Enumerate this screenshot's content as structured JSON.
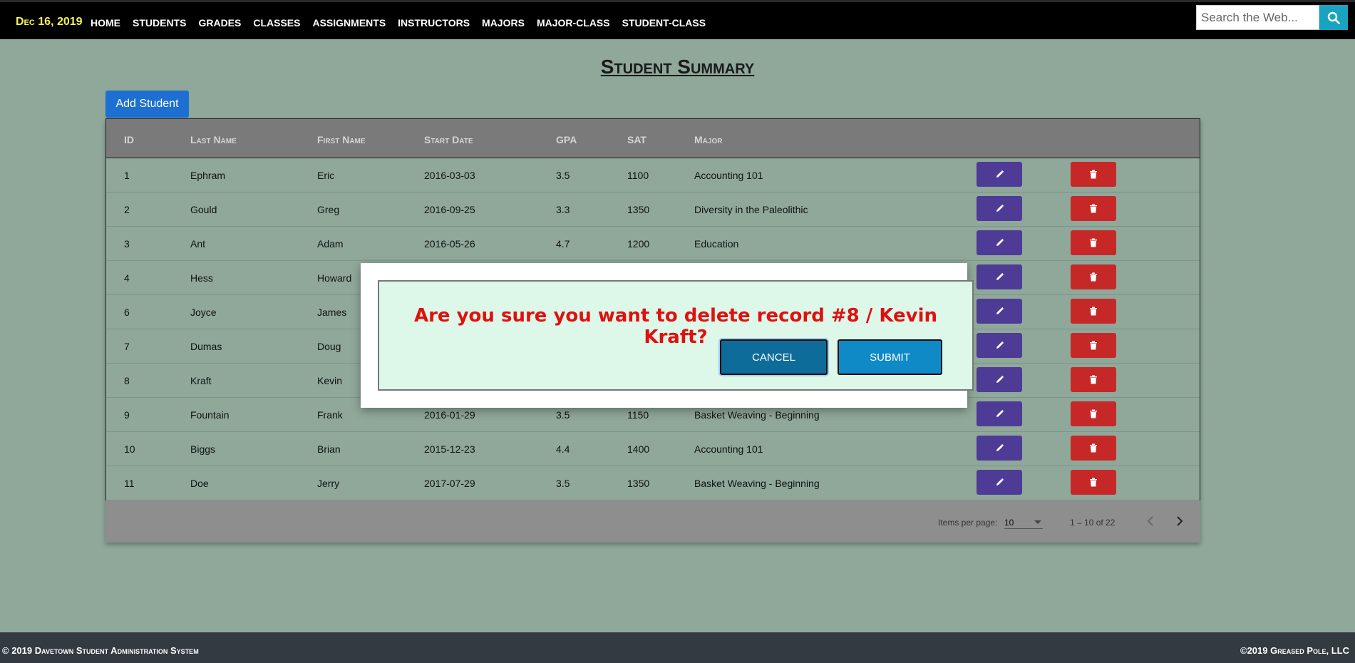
{
  "nav": {
    "date": "Dec 16, 2019",
    "links": [
      "HOME",
      "STUDENTS",
      "GRADES",
      "CLASSES",
      "ASSIGNMENTS",
      "INSTRUCTORS",
      "MAJORS",
      "MAJOR-CLASS",
      "STUDENT-CLASS"
    ],
    "search_placeholder": "Search the Web...",
    "search_icon": "search-icon"
  },
  "main": {
    "title": "Student Summary",
    "add_button": "Add Student",
    "columns": [
      "ID",
      "Last Name",
      "First Name",
      "Start Date",
      "GPA",
      "SAT",
      "Major"
    ],
    "rows": [
      {
        "id": "1",
        "last": "Ephram",
        "first": "Eric",
        "start": "2016-03-03",
        "gpa": "3.5",
        "sat": "1100",
        "major": "Accounting 101"
      },
      {
        "id": "2",
        "last": "Gould",
        "first": "Greg",
        "start": "2016-09-25",
        "gpa": "3.3",
        "sat": "1350",
        "major": "Diversity in the Paleolithic"
      },
      {
        "id": "3",
        "last": "Ant",
        "first": "Adam",
        "start": "2016-05-26",
        "gpa": "4.7",
        "sat": "1200",
        "major": "Education"
      },
      {
        "id": "4",
        "last": "Hess",
        "first": "Howard",
        "start": "",
        "gpa": "",
        "sat": "",
        "major": ""
      },
      {
        "id": "6",
        "last": "Joyce",
        "first": "James",
        "start": "",
        "gpa": "",
        "sat": "",
        "major": ""
      },
      {
        "id": "7",
        "last": "Dumas",
        "first": "Doug",
        "start": "",
        "gpa": "",
        "sat": "",
        "major": ""
      },
      {
        "id": "8",
        "last": "Kraft",
        "first": "Kevin",
        "start": "",
        "gpa": "",
        "sat": "",
        "major": ""
      },
      {
        "id": "9",
        "last": "Fountain",
        "first": "Frank",
        "start": "2016-01-29",
        "gpa": "3.5",
        "sat": "1150",
        "major": "Basket Weaving - Beginning"
      },
      {
        "id": "10",
        "last": "Biggs",
        "first": "Brian",
        "start": "2015-12-23",
        "gpa": "4.4",
        "sat": "1400",
        "major": "Accounting 101"
      },
      {
        "id": "11",
        "last": "Doe",
        "first": "Jerry",
        "start": "2017-07-29",
        "gpa": "3.5",
        "sat": "1350",
        "major": "Basket Weaving - Beginning"
      }
    ],
    "pager": {
      "items_label": "Items per page:",
      "items_value": "10",
      "range": "1 – 10 of 22"
    }
  },
  "modal": {
    "message": "Are you sure you want to delete record #8 / Kevin Kraft?",
    "cancel": "CANCEL",
    "submit": "SUBMIT"
  },
  "footer": {
    "left": "© 2019 Davetown Student Administration System",
    "right": "©2019 Greased Pole, LLC"
  },
  "colors": {
    "background": "#8fa89a",
    "edit_button": "#4e3b96",
    "delete_button": "#c62828",
    "modal_text": "#e01010",
    "accent": "#1d6fd1"
  }
}
